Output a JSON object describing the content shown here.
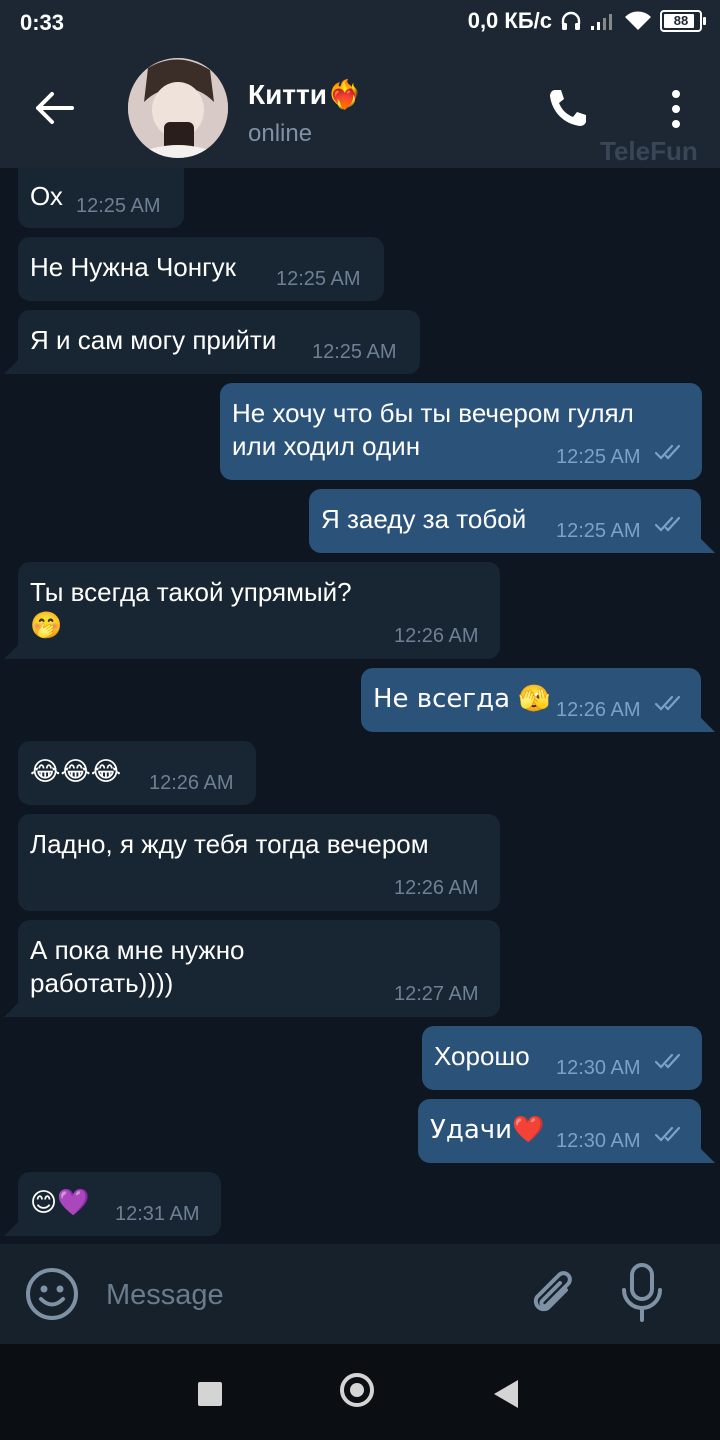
{
  "status_bar": {
    "time": "0:33",
    "network": "0,0 КБ/с",
    "battery": "88"
  },
  "header": {
    "name": "Китти",
    "name_emoji": "❤️‍🔥",
    "status": "online",
    "watermark": "TeleFun"
  },
  "messages": [
    {
      "dir": "in",
      "lines": [
        "Ох"
      ],
      "time": "12:25 AM"
    },
    {
      "dir": "in",
      "lines": [
        "Не Нужна Чонгук"
      ],
      "time": "12:25 AM"
    },
    {
      "dir": "in",
      "lines": [
        "Я и сам могу прийти"
      ],
      "time": "12:25 AM"
    },
    {
      "dir": "out",
      "lines": [
        "Не хочу что бы ты вечером гулял",
        "или ходил один"
      ],
      "time": "12:25 AM"
    },
    {
      "dir": "out",
      "lines": [
        "Я заеду за тобой"
      ],
      "time": "12:25 AM"
    },
    {
      "dir": "in",
      "lines": [
        "Ты всегда такой упрямый?",
        "🤭"
      ],
      "time": "12:26 AM"
    },
    {
      "dir": "out",
      "lines": [
        "Не всегда 🫣"
      ],
      "time": "12:26 AM"
    },
    {
      "dir": "in",
      "lines": [
        "😂😂😂"
      ],
      "time": "12:26 AM"
    },
    {
      "dir": "in",
      "lines": [
        "Ладно, я жду тебя тогда вечером"
      ],
      "time": "12:26 AM"
    },
    {
      "dir": "in",
      "lines": [
        "А пока мне нужно",
        "работать))))"
      ],
      "time": "12:27 AM"
    },
    {
      "dir": "out",
      "lines": [
        "Хорошо"
      ],
      "time": "12:30 AM"
    },
    {
      "dir": "out",
      "lines": [
        "Удачи❤️"
      ],
      "time": "12:30 AM"
    },
    {
      "dir": "in",
      "lines": [
        "😊💜"
      ],
      "time": "12:31 AM"
    }
  ],
  "input": {
    "placeholder": "Message"
  },
  "colors": {
    "background": "#0e1621",
    "header": "#1d2733",
    "incoming_bubble": "#182533",
    "outgoing_bubble": "#2b5278",
    "time_text": "#6d8094",
    "read_ticks": "#7aa3c8"
  },
  "icons": [
    "back-arrow-icon",
    "phone-icon",
    "more-vert-icon",
    "emoji-icon",
    "attach-icon",
    "mic-icon",
    "read-ticks-icon"
  ]
}
